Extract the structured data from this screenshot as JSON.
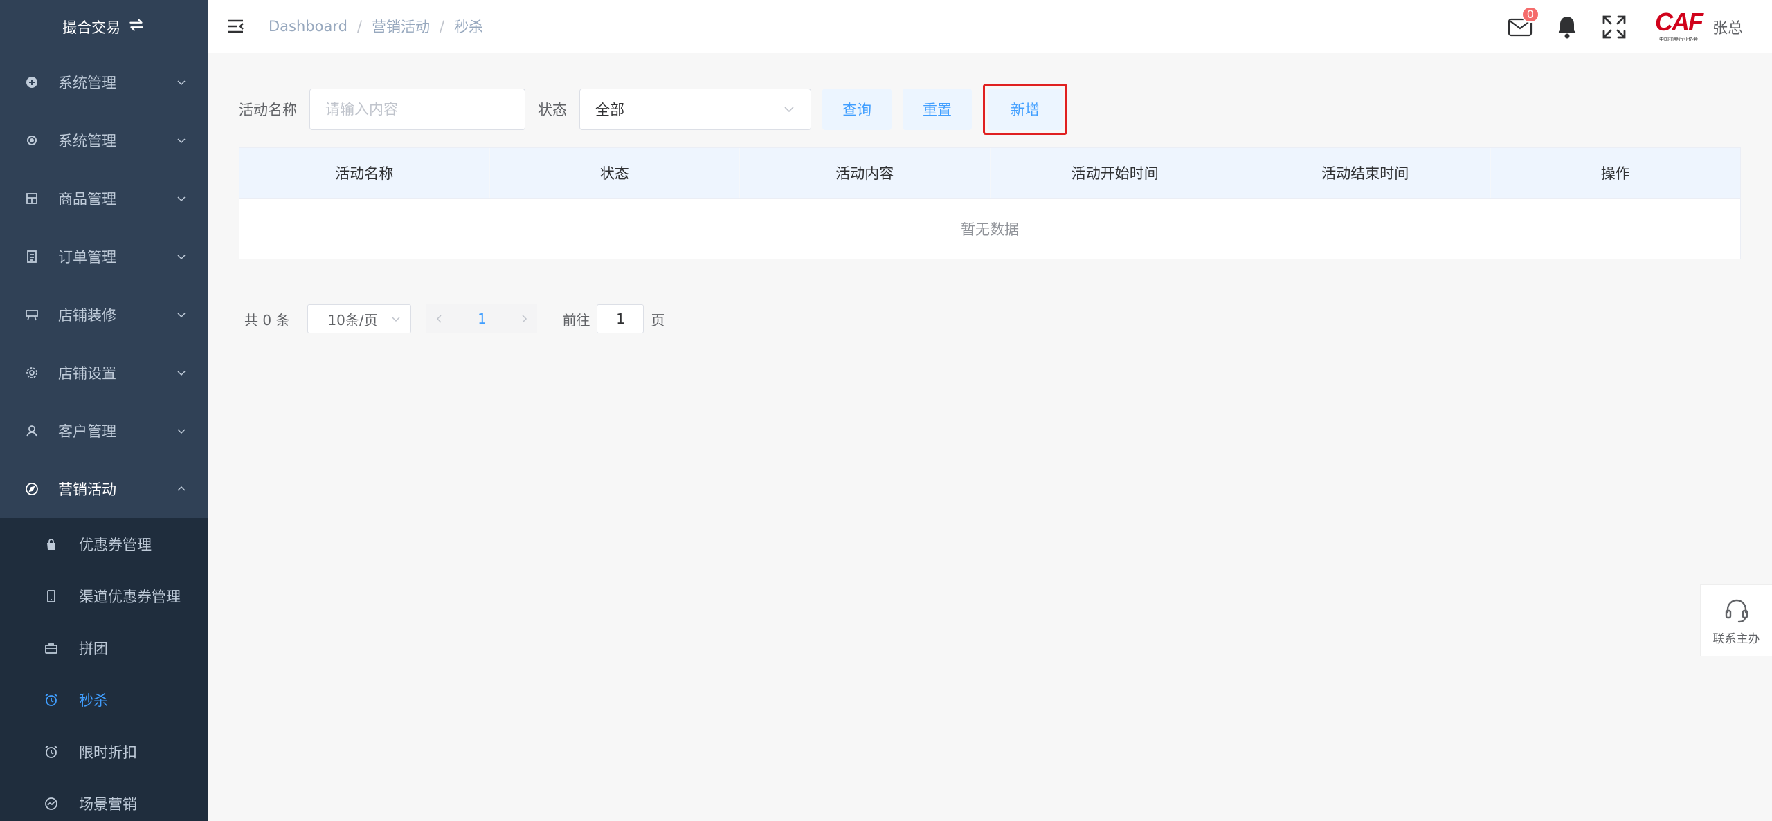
{
  "brand": {
    "title": "撮合交易"
  },
  "sidebar": {
    "menus": [
      {
        "label": "系统管理",
        "icon": "plus-circle-icon"
      },
      {
        "label": "系统管理",
        "icon": "settings-icon"
      },
      {
        "label": "商品管理",
        "icon": "goods-icon"
      },
      {
        "label": "订单管理",
        "icon": "order-icon"
      },
      {
        "label": "店铺装修",
        "icon": "shop-decoration-icon"
      },
      {
        "label": "店铺设置",
        "icon": "shop-settings-icon"
      },
      {
        "label": "客户管理",
        "icon": "user-icon"
      },
      {
        "label": "营销活动",
        "icon": "compass-icon"
      }
    ],
    "submenu": [
      {
        "label": "优惠券管理",
        "icon": "bag-icon"
      },
      {
        "label": "渠道优惠券管理",
        "icon": "phone-icon"
      },
      {
        "label": "拼团",
        "icon": "briefcase-icon"
      },
      {
        "label": "秒杀",
        "icon": "alarm-clock-icon",
        "active": true
      },
      {
        "label": "限时折扣",
        "icon": "alarm-clock-icon"
      },
      {
        "label": "场景营销",
        "icon": "chart-icon"
      }
    ]
  },
  "header": {
    "breadcrumb": [
      "Dashboard",
      "营销活动",
      "秒杀"
    ],
    "mail_count": "0",
    "logo_text": "CAF",
    "logo_sub": "中国拍卖行业协会",
    "username": "张总"
  },
  "filter": {
    "name_label": "活动名称",
    "name_placeholder": "请输入内容",
    "status_label": "状态",
    "status_value": "全部",
    "query_label": "查询",
    "reset_label": "重置",
    "add_label": "新增"
  },
  "table": {
    "columns": [
      "活动名称",
      "状态",
      "活动内容",
      "活动开始时间",
      "活动结束时间",
      "操作"
    ],
    "empty_text": "暂无数据"
  },
  "pagination": {
    "total_text": "共 0 条",
    "page_size": "10条/页",
    "current_page": "1",
    "goto_label": "前往",
    "goto_value": "1",
    "page_suffix": "页"
  },
  "support": {
    "label": "联系主办"
  },
  "colors": {
    "sidebar_bg": "#304156",
    "submenu_bg": "#1f2d3d",
    "primary": "#409eff",
    "highlight": "#e02020"
  }
}
